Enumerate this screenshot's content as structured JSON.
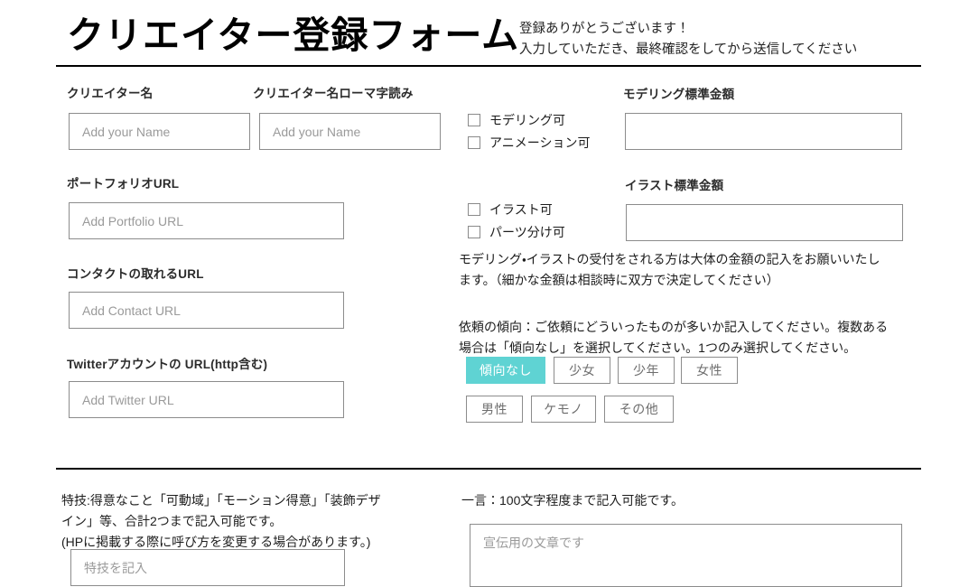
{
  "header": {
    "title": "クリエイター登録フォーム",
    "note_line1": "登録ありがとうございます！",
    "note_line2": "入力していただき、最終確認をしてから送信してください"
  },
  "fields": {
    "creator_name": {
      "label": "クリエイター名",
      "placeholder": "Add your Name",
      "value": ""
    },
    "creator_name_romaji": {
      "label": "クリエイター名ローマ字読み",
      "placeholder": "Add your Name",
      "value": ""
    },
    "portfolio_url": {
      "label": "ポートフォリオURL",
      "placeholder": "Add Portfolio URL",
      "value": ""
    },
    "contact_url": {
      "label": "コンタクトの取れるURL",
      "placeholder": "Add Contact URL",
      "value": ""
    },
    "twitter_url": {
      "label": "Twitterアカウントの URL(http含む)",
      "placeholder": "Add Twitter URL",
      "value": ""
    },
    "modeling_price": {
      "label": "モデリング標準金額",
      "placeholder": "",
      "value": ""
    },
    "illust_price": {
      "label": "イラスト標準金額",
      "placeholder": "",
      "value": ""
    },
    "specialty": {
      "placeholder": "特技を記入",
      "value": ""
    },
    "comment": {
      "placeholder": "宣伝用の文章です",
      "value": ""
    }
  },
  "checkboxes": [
    {
      "label": "モデリング可",
      "checked": false
    },
    {
      "label": "アニメーション可",
      "checked": false
    },
    {
      "label": "イラスト可",
      "checked": false
    },
    {
      "label": "パーツ分け可",
      "checked": false
    }
  ],
  "notes": {
    "price_note_line1": "モデリング・イラストの受付をされる方は大体の金額の記入をお願いいたし",
    "price_note_line2": "ます。（細かな金額は相談時に双方で決定してください）",
    "tendency_note_line1": "依頼の傾向：ご依頼にどういったものが多いか記入してください。複数ある",
    "tendency_note_line2": "場合は「傾向なし」を選択してください。1つのみ選択してください。",
    "specialty_note_line1": "特技:得意なこと「可動域」「モーション得意」「装飾デザ",
    "specialty_note_line2": "イン」等、合計2つまで記入可能です。",
    "specialty_note_line3": "(HPに掲載する際に呼び方を変更する場合があります。)",
    "comment_note": "一言：100文字程度まで記入可能です。"
  },
  "tendency_tags": [
    {
      "label": "傾向なし",
      "selected": true
    },
    {
      "label": "少女",
      "selected": false
    },
    {
      "label": "少年",
      "selected": false
    },
    {
      "label": "女性",
      "selected": false
    },
    {
      "label": "男性",
      "selected": false
    },
    {
      "label": "ケモノ",
      "selected": false
    },
    {
      "label": "その他",
      "selected": false
    }
  ],
  "colors": {
    "accent": "#5fd3d3",
    "border": "#8c8c8c",
    "placeholder": "#9a9a9a",
    "text": "#1c1c1c"
  }
}
